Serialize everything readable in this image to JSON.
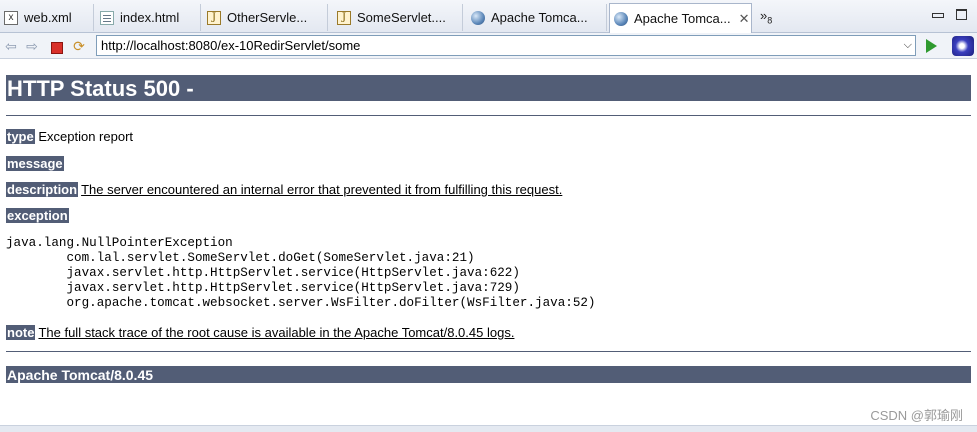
{
  "tabs": [
    {
      "label": "web.xml",
      "icon": "xml-file-icon"
    },
    {
      "label": "index.html",
      "icon": "html-file-icon"
    },
    {
      "label": "OtherServle...",
      "icon": "java-file-icon"
    },
    {
      "label": "SomeServlet....",
      "icon": "java-file-icon"
    },
    {
      "label": "Apache Tomca...",
      "icon": "globe-icon"
    },
    {
      "label": "Apache Tomca...",
      "icon": "globe-icon",
      "active": true
    }
  ],
  "tab_overflow": {
    "symbol": "»",
    "count": "8"
  },
  "window_controls": {
    "minimize": "▭",
    "maximize": "▭"
  },
  "toolbar": {
    "url": "http://localhost:8080/ex-10RedirServlet/some",
    "dropdown_icon": "chevron-down-icon"
  },
  "page": {
    "title": "HTTP Status 500 -",
    "type_label": "type",
    "type_value": "Exception report",
    "message_label": "message",
    "description_label": "description",
    "description_value": "The server encountered an internal error that prevented it from fulfilling this request.",
    "exception_label": "exception",
    "stack_trace": "java.lang.NullPointerException\n\tcom.lal.servlet.SomeServlet.doGet(SomeServlet.java:21)\n\tjavax.servlet.http.HttpServlet.service(HttpServlet.java:622)\n\tjavax.servlet.http.HttpServlet.service(HttpServlet.java:729)\n\torg.apache.tomcat.websocket.server.WsFilter.doFilter(WsFilter.java:52)",
    "note_label": "note",
    "note_value": "The full stack trace of the root cause is available in the Apache Tomcat/8.0.45 logs.",
    "footer": "Apache Tomcat/8.0.45"
  },
  "watermark": "CSDN @郭瑜刚",
  "colors": {
    "tomcat_header": "#525d76"
  }
}
